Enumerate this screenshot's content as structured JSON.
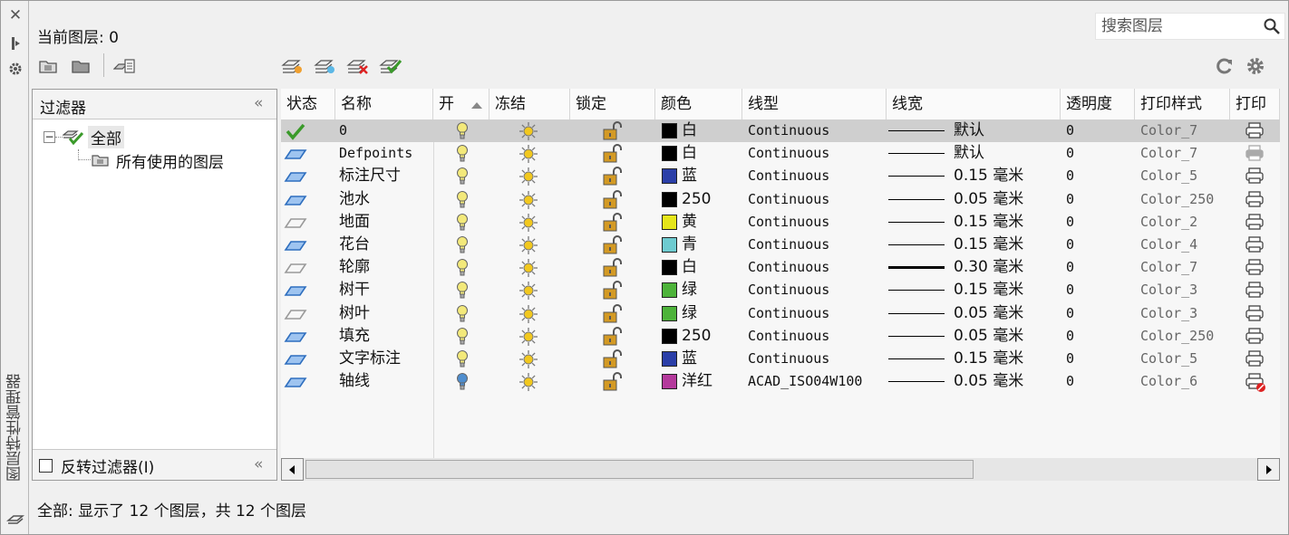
{
  "panel": {
    "title": "图层特性管理器",
    "current_layer_label": "当前图层: 0",
    "search_placeholder": "搜索图层",
    "status_text": "全部: 显示了 12 个图层，共 12 个图层"
  },
  "toolbar": {
    "left_icons": [
      "new-property-filter-icon",
      "new-group-filter-icon",
      "layer-states-manager-icon"
    ],
    "layer_icons": [
      "new-layer-icon",
      "new-layer-vp-frozen-icon",
      "delete-layer-icon",
      "set-current-icon"
    ],
    "right_icons": [
      "refresh-icon",
      "settings-icon"
    ]
  },
  "filters": {
    "title": "过滤器",
    "tree": {
      "root": "全部",
      "child": "所有使用的图层"
    },
    "invert_label": "反转过滤器(I)",
    "invert_checked": false
  },
  "table": {
    "columns": [
      "状态",
      "名称",
      "开",
      "冻结",
      "锁定",
      "颜色",
      "线型",
      "线宽",
      "透明度",
      "打印样式",
      "打印"
    ],
    "sorted_column": "名称",
    "rows": [
      {
        "status": "current",
        "name": "0",
        "on": true,
        "frozen": false,
        "locked": false,
        "color_label": "白",
        "color_hex": "#000000",
        "linetype": "Continuous",
        "lineweight": "默认",
        "lw_thick": false,
        "transparency": "0",
        "plot_style": "Color_7",
        "plot": "enabled",
        "selected": true
      },
      {
        "status": "in-use",
        "name": "Defpoints",
        "on": true,
        "frozen": false,
        "locked": false,
        "color_label": "白",
        "color_hex": "#000000",
        "linetype": "Continuous",
        "lineweight": "默认",
        "lw_thick": false,
        "transparency": "0",
        "plot_style": "Color_7",
        "plot": "disabled",
        "selected": false
      },
      {
        "status": "in-use",
        "name": "标注尺寸",
        "on": true,
        "frozen": false,
        "locked": false,
        "color_label": "蓝",
        "color_hex": "#2b3fa8",
        "linetype": "Continuous",
        "lineweight": "0.15 毫米",
        "lw_thick": false,
        "transparency": "0",
        "plot_style": "Color_5",
        "plot": "enabled",
        "selected": false
      },
      {
        "status": "in-use",
        "name": "池水",
        "on": true,
        "frozen": false,
        "locked": false,
        "color_label": "250",
        "color_hex": "#000000",
        "linetype": "Continuous",
        "lineweight": "0.05 毫米",
        "lw_thick": false,
        "transparency": "0",
        "plot_style": "Color_250",
        "plot": "enabled",
        "selected": false
      },
      {
        "status": "unused",
        "name": "地面",
        "on": true,
        "frozen": false,
        "locked": false,
        "color_label": "黄",
        "color_hex": "#e6e61a",
        "linetype": "Continuous",
        "lineweight": "0.15 毫米",
        "lw_thick": false,
        "transparency": "0",
        "plot_style": "Color_2",
        "plot": "enabled",
        "selected": false
      },
      {
        "status": "in-use",
        "name": "花台",
        "on": true,
        "frozen": false,
        "locked": false,
        "color_label": "青",
        "color_hex": "#6ecbd0",
        "linetype": "Continuous",
        "lineweight": "0.15 毫米",
        "lw_thick": false,
        "transparency": "0",
        "plot_style": "Color_4",
        "plot": "enabled",
        "selected": false
      },
      {
        "status": "unused",
        "name": "轮廓",
        "on": true,
        "frozen": false,
        "locked": false,
        "color_label": "白",
        "color_hex": "#000000",
        "linetype": "Continuous",
        "lineweight": "0.30 毫米",
        "lw_thick": true,
        "transparency": "0",
        "plot_style": "Color_7",
        "plot": "enabled",
        "selected": false
      },
      {
        "status": "in-use",
        "name": "树干",
        "on": true,
        "frozen": false,
        "locked": false,
        "color_label": "绿",
        "color_hex": "#4db33a",
        "linetype": "Continuous",
        "lineweight": "0.15 毫米",
        "lw_thick": false,
        "transparency": "0",
        "plot_style": "Color_3",
        "plot": "enabled",
        "selected": false
      },
      {
        "status": "unused",
        "name": "树叶",
        "on": true,
        "frozen": false,
        "locked": false,
        "color_label": "绿",
        "color_hex": "#4db33a",
        "linetype": "Continuous",
        "lineweight": "0.05 毫米",
        "lw_thick": false,
        "transparency": "0",
        "plot_style": "Color_3",
        "plot": "enabled",
        "selected": false
      },
      {
        "status": "in-use",
        "name": "填充",
        "on": true,
        "frozen": false,
        "locked": false,
        "color_label": "250",
        "color_hex": "#000000",
        "linetype": "Continuous",
        "lineweight": "0.05 毫米",
        "lw_thick": false,
        "transparency": "0",
        "plot_style": "Color_250",
        "plot": "enabled",
        "selected": false
      },
      {
        "status": "in-use",
        "name": "文字标注",
        "on": true,
        "frozen": false,
        "locked": false,
        "color_label": "蓝",
        "color_hex": "#2b3fa8",
        "linetype": "Continuous",
        "lineweight": "0.15 毫米",
        "lw_thick": false,
        "transparency": "0",
        "plot_style": "Color_5",
        "plot": "enabled",
        "selected": false
      },
      {
        "status": "in-use",
        "name": "轴线",
        "on": false,
        "frozen": false,
        "locked": false,
        "color_label": "洋红",
        "color_hex": "#b43a9c",
        "linetype": "ACAD_ISO04W100",
        "lineweight": "0.05 毫米",
        "lw_thick": false,
        "transparency": "0",
        "plot_style": "Color_6",
        "plot": "no-plot",
        "selected": false
      }
    ]
  },
  "colors": {
    "status_blue": "#2f6fbf",
    "bulb_on": "#f3e97a",
    "bulb_off": "#4f8ecf",
    "sun": "#f2c81e",
    "lock": "#d49a24",
    "check_green": "#3a9a2a"
  }
}
